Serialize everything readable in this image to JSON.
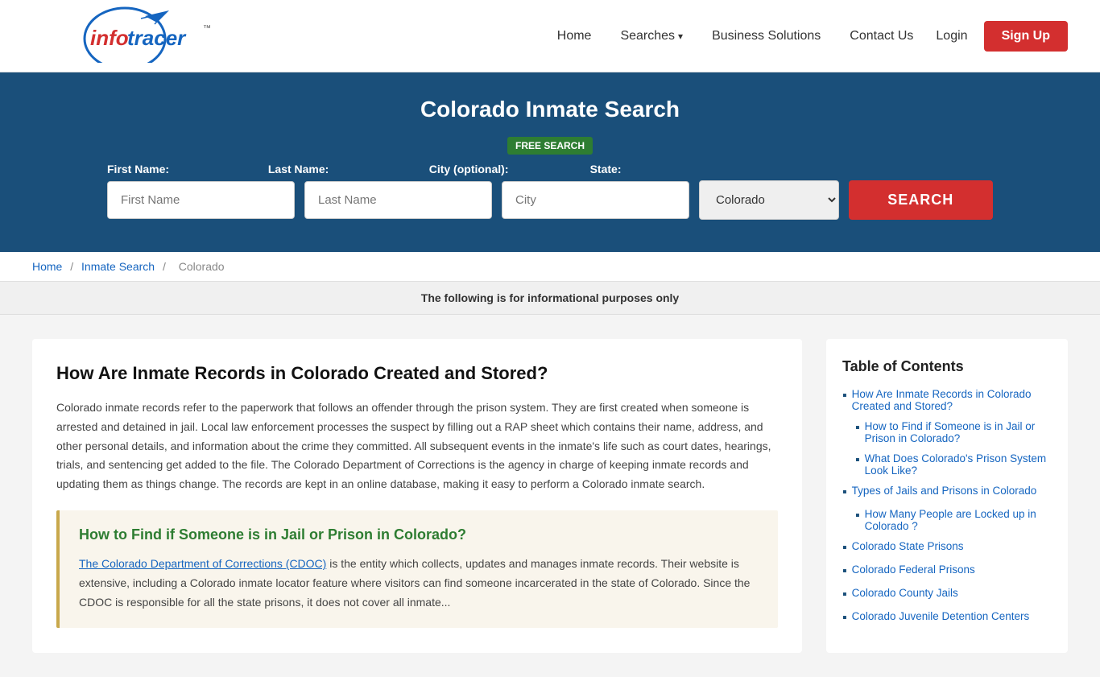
{
  "header": {
    "logo_text_info": "info",
    "logo_text_tracer": "tracer",
    "logo_tm": "™",
    "nav": {
      "home": "Home",
      "searches": "Searches",
      "business_solutions": "Business Solutions",
      "contact_us": "Contact Us",
      "login": "Login",
      "signup": "Sign Up"
    }
  },
  "hero": {
    "title": "Colorado Inmate Search",
    "free_badge": "FREE SEARCH",
    "fields": {
      "first_name_label": "First Name:",
      "last_name_label": "Last Name:",
      "city_label": "City (optional):",
      "state_label": "State:",
      "first_name_placeholder": "First Name",
      "last_name_placeholder": "Last Name",
      "city_placeholder": "City",
      "state_value": "Colorado",
      "search_button": "SEARCH"
    }
  },
  "breadcrumb": {
    "home": "Home",
    "inmate_search": "Inmate Search",
    "state": "Colorado",
    "sep": "/"
  },
  "notice": "The following is for informational purposes only",
  "article": {
    "h1": "How Are Inmate Records in Colorado Created and Stored?",
    "p1": "Colorado inmate records refer to the paperwork that follows an offender through the prison system. They are first created when someone is arrested and detained in jail. Local law enforcement processes the suspect by filling out a RAP sheet which contains their name, address, and other personal details, and information about the crime they committed. All subsequent events in the inmate's life such as court dates, hearings, trials, and sentencing get added to the file. The Colorado Department of Corrections is the agency in charge of keeping inmate records and updating them as things change. The records are kept in an online database, making it easy to perform a Colorado inmate search.",
    "sub_section": {
      "h2": "How to Find if Someone is in Jail or Prison in Colorado?",
      "link_text": "The Colorado Department of Corrections (CDOC)",
      "p": " is the entity which collects, updates and manages inmate records. Their website is extensive, including a Colorado inmate locator feature where visitors can find someone incarcerated in the state of Colorado. Since the CDOC is responsible for all the state prisons, it does not cover all inmate..."
    }
  },
  "toc": {
    "title": "Table of Contents",
    "items": [
      {
        "label": "How Are Inmate Records in Colorado Created and Stored?",
        "indent": false
      },
      {
        "label": "How to Find if Someone is in Jail or Prison in Colorado?",
        "indent": true
      },
      {
        "label": "What Does Colorado's Prison System Look Like?",
        "indent": true
      },
      {
        "label": "Types of Jails and Prisons in Colorado",
        "indent": false
      },
      {
        "label": "How Many People are Locked up in Colorado ?",
        "indent": true
      },
      {
        "label": "Colorado State Prisons",
        "indent": false
      },
      {
        "label": "Colorado Federal Prisons",
        "indent": false
      },
      {
        "label": "Colorado County Jails",
        "indent": false
      },
      {
        "label": "Colorado Juvenile Detention Centers",
        "indent": false
      }
    ]
  }
}
